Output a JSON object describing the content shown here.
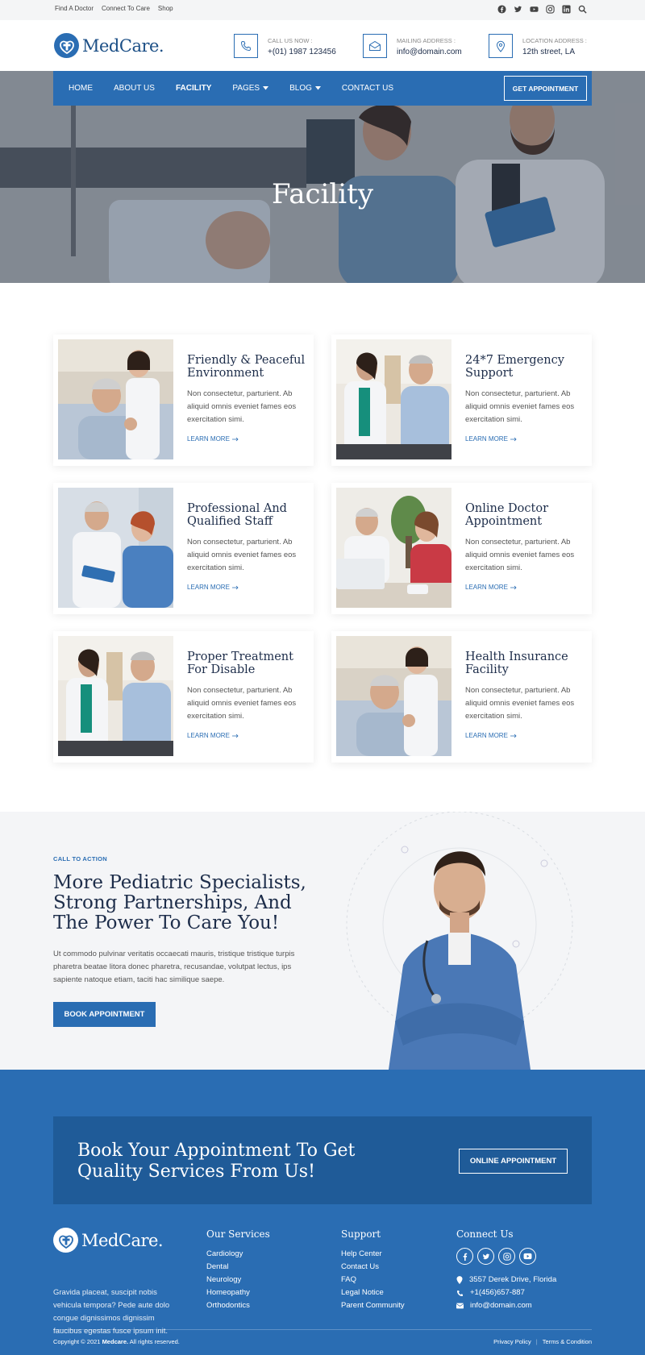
{
  "topbar": {
    "links": [
      "Find A Doctor",
      "Connect To Care",
      "Shop"
    ],
    "social_icons": [
      "facebook-icon",
      "twitter-icon",
      "youtube-icon",
      "instagram-icon",
      "linkedin-icon",
      "search-icon"
    ]
  },
  "header": {
    "logo_text": "MedCare.",
    "contacts": [
      {
        "icon": "phone-icon",
        "label": "CALL US NOW :",
        "value": "+(01) 1987 123456"
      },
      {
        "icon": "mail-icon",
        "label": "MAILING ADDRESS :",
        "value": "info@domain.com"
      },
      {
        "icon": "location-icon",
        "label": "LOCATION ADDRESS :",
        "value": "12th street, LA"
      }
    ]
  },
  "nav": {
    "items": [
      {
        "label": "HOME",
        "dropdown": false
      },
      {
        "label": "ABOUT US",
        "dropdown": false
      },
      {
        "label": "FACILITY",
        "dropdown": false
      },
      {
        "label": "PAGES",
        "dropdown": true
      },
      {
        "label": "BLOG",
        "dropdown": true
      },
      {
        "label": "CONTACT US",
        "dropdown": false
      }
    ],
    "active": "FACILITY",
    "cta": "GET APPOINTMENT"
  },
  "hero": {
    "title": "Facility"
  },
  "facilities": [
    {
      "title": "Friendly & Peaceful Environment",
      "desc": "Non consectetur, parturient. Ab aliquid omnis eveniet fames eos exercitation simi.",
      "link": "LEARN MORE"
    },
    {
      "title": "24*7 Emergency Support",
      "desc": "Non consectetur, parturient. Ab aliquid omnis eveniet fames eos exercitation simi.",
      "link": "LEARN MORE"
    },
    {
      "title": "Professional And Qualified Staff",
      "desc": "Non consectetur, parturient. Ab aliquid omnis eveniet fames eos exercitation simi.",
      "link": "LEARN MORE"
    },
    {
      "title": "Online Doctor Appointment",
      "desc": "Non consectetur, parturient. Ab aliquid omnis eveniet fames eos exercitation simi.",
      "link": "LEARN MORE"
    },
    {
      "title": "Proper Treatment For Disable",
      "desc": "Non consectetur, parturient. Ab aliquid omnis eveniet fames eos exercitation simi.",
      "link": "LEARN MORE"
    },
    {
      "title": "Health Insurance Facility",
      "desc": "Non consectetur, parturient. Ab aliquid omnis eveniet fames eos exercitation simi.",
      "link": "LEARN MORE"
    }
  ],
  "cta": {
    "kicker": "CALL TO ACTION",
    "title": "More Pediatric Specialists, Strong Partnerships, And The Power To Care You!",
    "text": "Ut commodo pulvinar veritatis occaecati mauris, tristique tristique turpis pharetra beatae litora donec pharetra, recusandae, volutpat lectus, ips sapiente natoque etiam, taciti hac similique saepe.",
    "button": "BOOK APPOINTMENT"
  },
  "footer": {
    "banner_title": "Book Your Appointment To Get Quality Services From Us!",
    "banner_button": "ONLINE APPOINTMENT",
    "logo_text": "MedCare.",
    "about": "Gravida placeat, suscipit nobis vehicula tempora? Pede aute dolo congue dignissimos dignissim faucibus egestas fusce ipsum init.",
    "services_title": "Our Services",
    "services": [
      "Cardiology",
      "Dental",
      "Neurology",
      "Homeopathy",
      "Orthodontics"
    ],
    "support_title": "Support",
    "support": [
      "Help Center",
      "Contact Us",
      "FAQ",
      "Legal Notice",
      "Parent Community"
    ],
    "connect_title": "Connect Us",
    "connect_social": [
      "facebook-icon",
      "twitter-icon",
      "instagram-icon",
      "youtube-icon"
    ],
    "address": "3557 Derek Drive, Florida",
    "phone": "+1(456)657-887",
    "email": "info@domain.com",
    "copyright_prefix": "Copyright © 2021 ",
    "copyright_brand": "Medcare.",
    "copyright_suffix": " All rights reserved.",
    "privacy": "Privacy Policy",
    "terms": "Terms & Condition"
  },
  "colors": {
    "primary": "#2a6db3",
    "dark_blue": "#1f5b98",
    "heading": "#1d2d4a"
  }
}
